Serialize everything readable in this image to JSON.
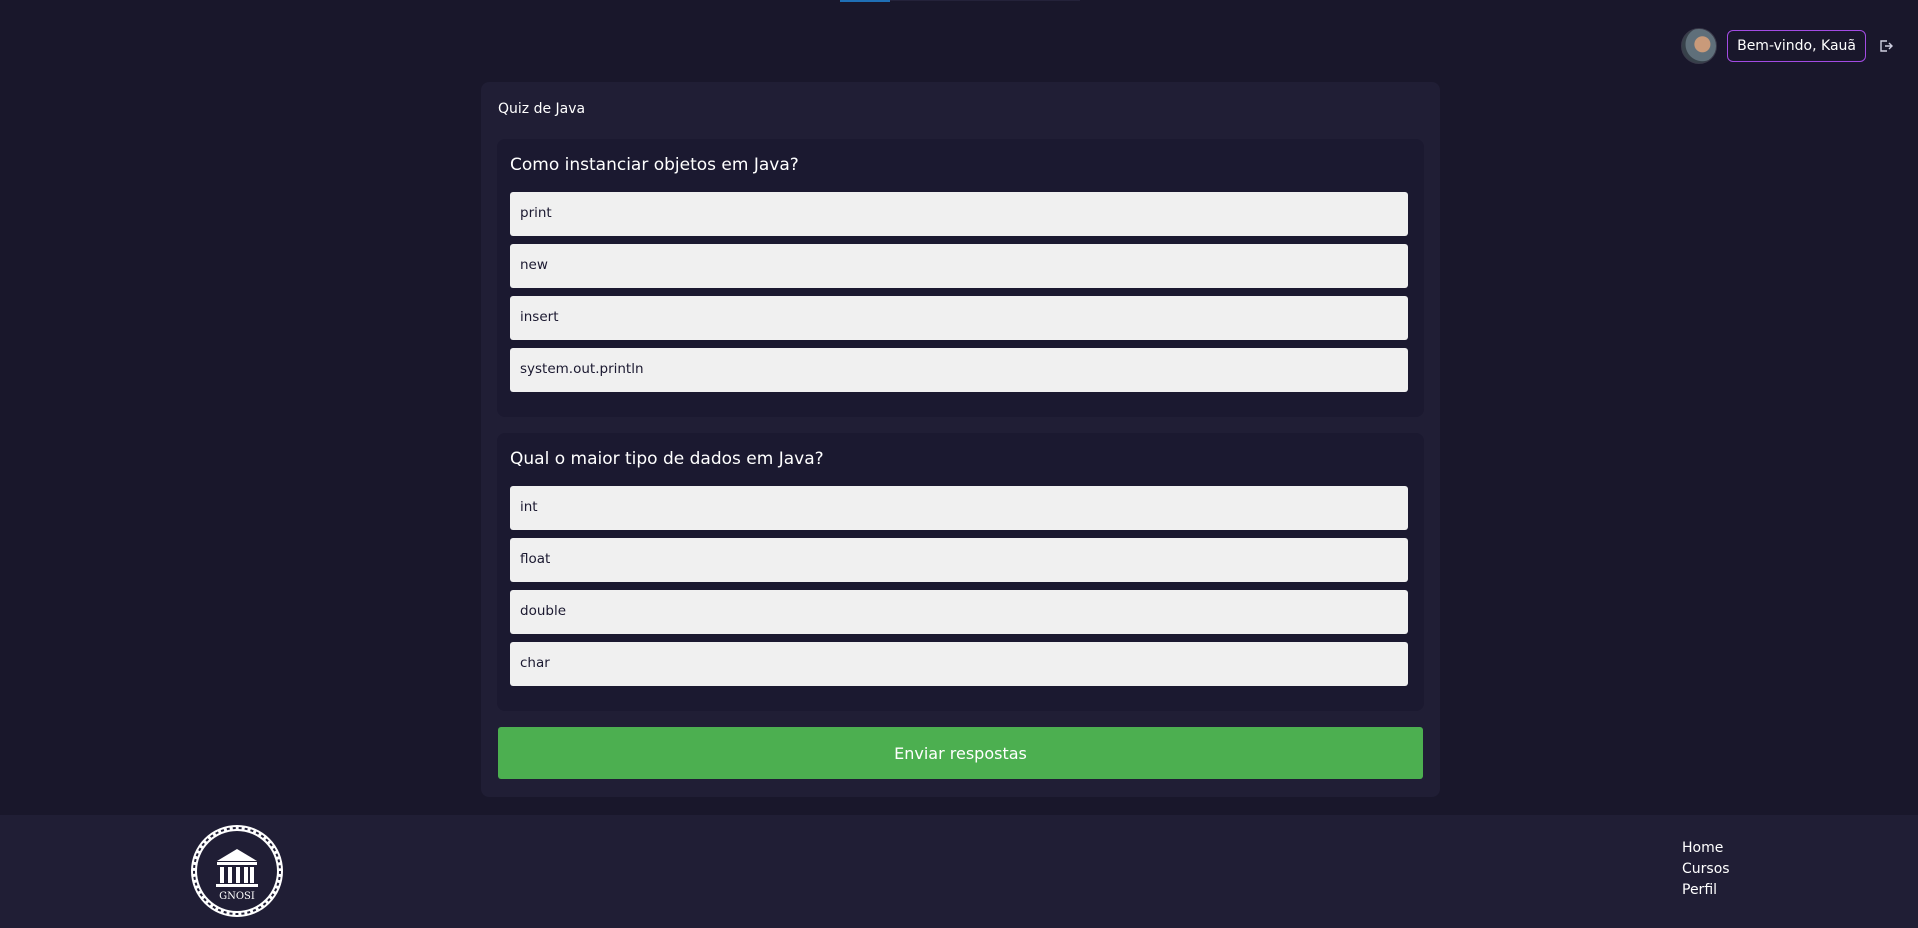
{
  "header": {
    "welcome_label": "Bem-vindo, Kauã",
    "avatar_icon": "user-avatar",
    "logout_icon": "logout-icon"
  },
  "quiz": {
    "title": "Quiz de Java",
    "questions": [
      {
        "text": "Como instanciar objetos em Java?",
        "options": [
          "print",
          "new",
          "insert",
          "system.out.println"
        ]
      },
      {
        "text": "Qual o maior tipo de dados em Java?",
        "options": [
          "int",
          "float",
          "double",
          "char"
        ]
      }
    ],
    "submit_label": "Enviar respostas"
  },
  "footer": {
    "logo_text": "GNOSI",
    "links": [
      "Home",
      "Cursos",
      "Perfil"
    ]
  },
  "colors": {
    "background": "#19172b",
    "card": "#201e35",
    "accent_border": "#a24be3",
    "submit_button": "#4caf50"
  }
}
